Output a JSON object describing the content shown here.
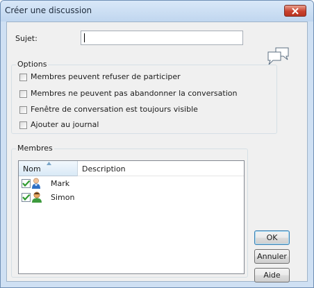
{
  "window": {
    "title": "Créer une discussion"
  },
  "subject": {
    "label": "Sujet:",
    "value": ""
  },
  "options": {
    "title": "Options",
    "items": [
      {
        "label": "Membres peuvent refuser de participer",
        "checked": false
      },
      {
        "label": "Membres ne peuvent pas abandonner la conversation",
        "checked": false
      },
      {
        "label": "Fenêtre de conversation est toujours visible",
        "checked": false
      },
      {
        "label": "Ajouter au journal",
        "checked": false
      }
    ]
  },
  "members": {
    "title": "Membres",
    "columns": [
      "Nom",
      "Description"
    ],
    "rows": [
      {
        "name": "Mark",
        "description": "",
        "checked": true,
        "icon": "male-user-icon"
      },
      {
        "name": "Simon",
        "description": "",
        "checked": true,
        "icon": "user-icon"
      }
    ]
  },
  "buttons": {
    "ok": "OK",
    "cancel": "Annuler",
    "help": "Aide"
  },
  "colors": {
    "close_button": "#c8412e",
    "checkmark": "#2f9a2f"
  }
}
